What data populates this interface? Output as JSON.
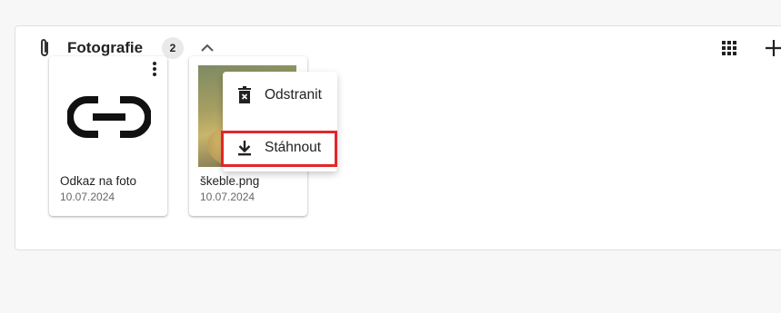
{
  "section": {
    "title": "Fotografie",
    "count": "2"
  },
  "attachments": [
    {
      "name": "Odkaz na foto",
      "date": "10.07.2024",
      "icon": "link-icon"
    },
    {
      "name": "škeble.png",
      "date": "10.07.2024",
      "icon": "image-thumbnail"
    }
  ],
  "context_menu": {
    "items": [
      {
        "label": "Odstranit",
        "icon": "trash-icon"
      },
      {
        "label": "Stáhnout",
        "icon": "download-icon"
      }
    ]
  },
  "colors": {
    "highlight": "#e2262b"
  }
}
